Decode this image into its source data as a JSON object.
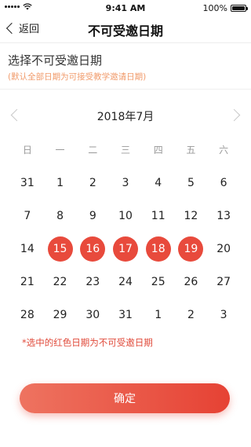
{
  "status_bar": {
    "time": "9:41 AM",
    "battery": "100%"
  },
  "nav": {
    "back_label": "返回",
    "title": "不可受邀日期"
  },
  "section": {
    "title": "选择不可受邀日期",
    "hint": "(默认全部日期为可接受教学邀请日期)"
  },
  "calendar": {
    "month_label": "2018年7月",
    "weekdays": [
      "日",
      "一",
      "二",
      "三",
      "四",
      "五",
      "六"
    ],
    "days": [
      "31",
      "1",
      "2",
      "3",
      "4",
      "5",
      "6",
      "7",
      "8",
      "9",
      "10",
      "11",
      "12",
      "13",
      "14",
      "15",
      "16",
      "17",
      "18",
      "19",
      "20",
      "21",
      "22",
      "23",
      "24",
      "25",
      "26",
      "27",
      "28",
      "29",
      "30",
      "31",
      "1",
      "2",
      "3"
    ],
    "selected": [
      "15",
      "16",
      "17",
      "18",
      "19"
    ],
    "selected_color": "#e84a3c"
  },
  "legend": {
    "note": "*选中的红色日期为不可受邀日期"
  },
  "confirm": {
    "label": "确定",
    "color": "#e64234"
  },
  "icons": {
    "back": "chevron-left-icon",
    "prev": "chevron-left-icon",
    "next": "chevron-right-icon"
  }
}
